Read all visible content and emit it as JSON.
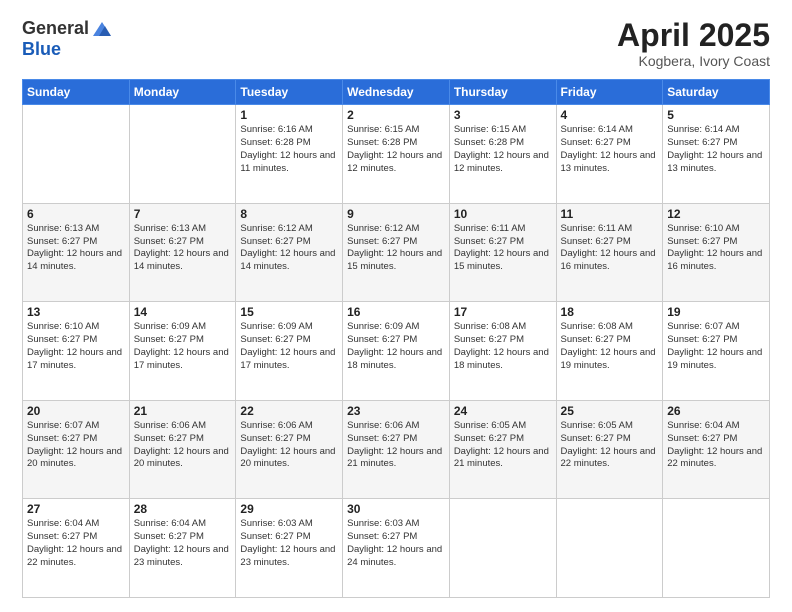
{
  "header": {
    "logo_general": "General",
    "logo_blue": "Blue",
    "title": "April 2025",
    "location": "Kogbera, Ivory Coast"
  },
  "days_of_week": [
    "Sunday",
    "Monday",
    "Tuesday",
    "Wednesday",
    "Thursday",
    "Friday",
    "Saturday"
  ],
  "weeks": [
    [
      {
        "day": "",
        "info": ""
      },
      {
        "day": "",
        "info": ""
      },
      {
        "day": "1",
        "info": "Sunrise: 6:16 AM\nSunset: 6:28 PM\nDaylight: 12 hours and 11 minutes."
      },
      {
        "day": "2",
        "info": "Sunrise: 6:15 AM\nSunset: 6:28 PM\nDaylight: 12 hours and 12 minutes."
      },
      {
        "day": "3",
        "info": "Sunrise: 6:15 AM\nSunset: 6:28 PM\nDaylight: 12 hours and 12 minutes."
      },
      {
        "day": "4",
        "info": "Sunrise: 6:14 AM\nSunset: 6:27 PM\nDaylight: 12 hours and 13 minutes."
      },
      {
        "day": "5",
        "info": "Sunrise: 6:14 AM\nSunset: 6:27 PM\nDaylight: 12 hours and 13 minutes."
      }
    ],
    [
      {
        "day": "6",
        "info": "Sunrise: 6:13 AM\nSunset: 6:27 PM\nDaylight: 12 hours and 14 minutes."
      },
      {
        "day": "7",
        "info": "Sunrise: 6:13 AM\nSunset: 6:27 PM\nDaylight: 12 hours and 14 minutes."
      },
      {
        "day": "8",
        "info": "Sunrise: 6:12 AM\nSunset: 6:27 PM\nDaylight: 12 hours and 14 minutes."
      },
      {
        "day": "9",
        "info": "Sunrise: 6:12 AM\nSunset: 6:27 PM\nDaylight: 12 hours and 15 minutes."
      },
      {
        "day": "10",
        "info": "Sunrise: 6:11 AM\nSunset: 6:27 PM\nDaylight: 12 hours and 15 minutes."
      },
      {
        "day": "11",
        "info": "Sunrise: 6:11 AM\nSunset: 6:27 PM\nDaylight: 12 hours and 16 minutes."
      },
      {
        "day": "12",
        "info": "Sunrise: 6:10 AM\nSunset: 6:27 PM\nDaylight: 12 hours and 16 minutes."
      }
    ],
    [
      {
        "day": "13",
        "info": "Sunrise: 6:10 AM\nSunset: 6:27 PM\nDaylight: 12 hours and 17 minutes."
      },
      {
        "day": "14",
        "info": "Sunrise: 6:09 AM\nSunset: 6:27 PM\nDaylight: 12 hours and 17 minutes."
      },
      {
        "day": "15",
        "info": "Sunrise: 6:09 AM\nSunset: 6:27 PM\nDaylight: 12 hours and 17 minutes."
      },
      {
        "day": "16",
        "info": "Sunrise: 6:09 AM\nSunset: 6:27 PM\nDaylight: 12 hours and 18 minutes."
      },
      {
        "day": "17",
        "info": "Sunrise: 6:08 AM\nSunset: 6:27 PM\nDaylight: 12 hours and 18 minutes."
      },
      {
        "day": "18",
        "info": "Sunrise: 6:08 AM\nSunset: 6:27 PM\nDaylight: 12 hours and 19 minutes."
      },
      {
        "day": "19",
        "info": "Sunrise: 6:07 AM\nSunset: 6:27 PM\nDaylight: 12 hours and 19 minutes."
      }
    ],
    [
      {
        "day": "20",
        "info": "Sunrise: 6:07 AM\nSunset: 6:27 PM\nDaylight: 12 hours and 20 minutes."
      },
      {
        "day": "21",
        "info": "Sunrise: 6:06 AM\nSunset: 6:27 PM\nDaylight: 12 hours and 20 minutes."
      },
      {
        "day": "22",
        "info": "Sunrise: 6:06 AM\nSunset: 6:27 PM\nDaylight: 12 hours and 20 minutes."
      },
      {
        "day": "23",
        "info": "Sunrise: 6:06 AM\nSunset: 6:27 PM\nDaylight: 12 hours and 21 minutes."
      },
      {
        "day": "24",
        "info": "Sunrise: 6:05 AM\nSunset: 6:27 PM\nDaylight: 12 hours and 21 minutes."
      },
      {
        "day": "25",
        "info": "Sunrise: 6:05 AM\nSunset: 6:27 PM\nDaylight: 12 hours and 22 minutes."
      },
      {
        "day": "26",
        "info": "Sunrise: 6:04 AM\nSunset: 6:27 PM\nDaylight: 12 hours and 22 minutes."
      }
    ],
    [
      {
        "day": "27",
        "info": "Sunrise: 6:04 AM\nSunset: 6:27 PM\nDaylight: 12 hours and 22 minutes."
      },
      {
        "day": "28",
        "info": "Sunrise: 6:04 AM\nSunset: 6:27 PM\nDaylight: 12 hours and 23 minutes."
      },
      {
        "day": "29",
        "info": "Sunrise: 6:03 AM\nSunset: 6:27 PM\nDaylight: 12 hours and 23 minutes."
      },
      {
        "day": "30",
        "info": "Sunrise: 6:03 AM\nSunset: 6:27 PM\nDaylight: 12 hours and 24 minutes."
      },
      {
        "day": "",
        "info": ""
      },
      {
        "day": "",
        "info": ""
      },
      {
        "day": "",
        "info": ""
      }
    ]
  ]
}
